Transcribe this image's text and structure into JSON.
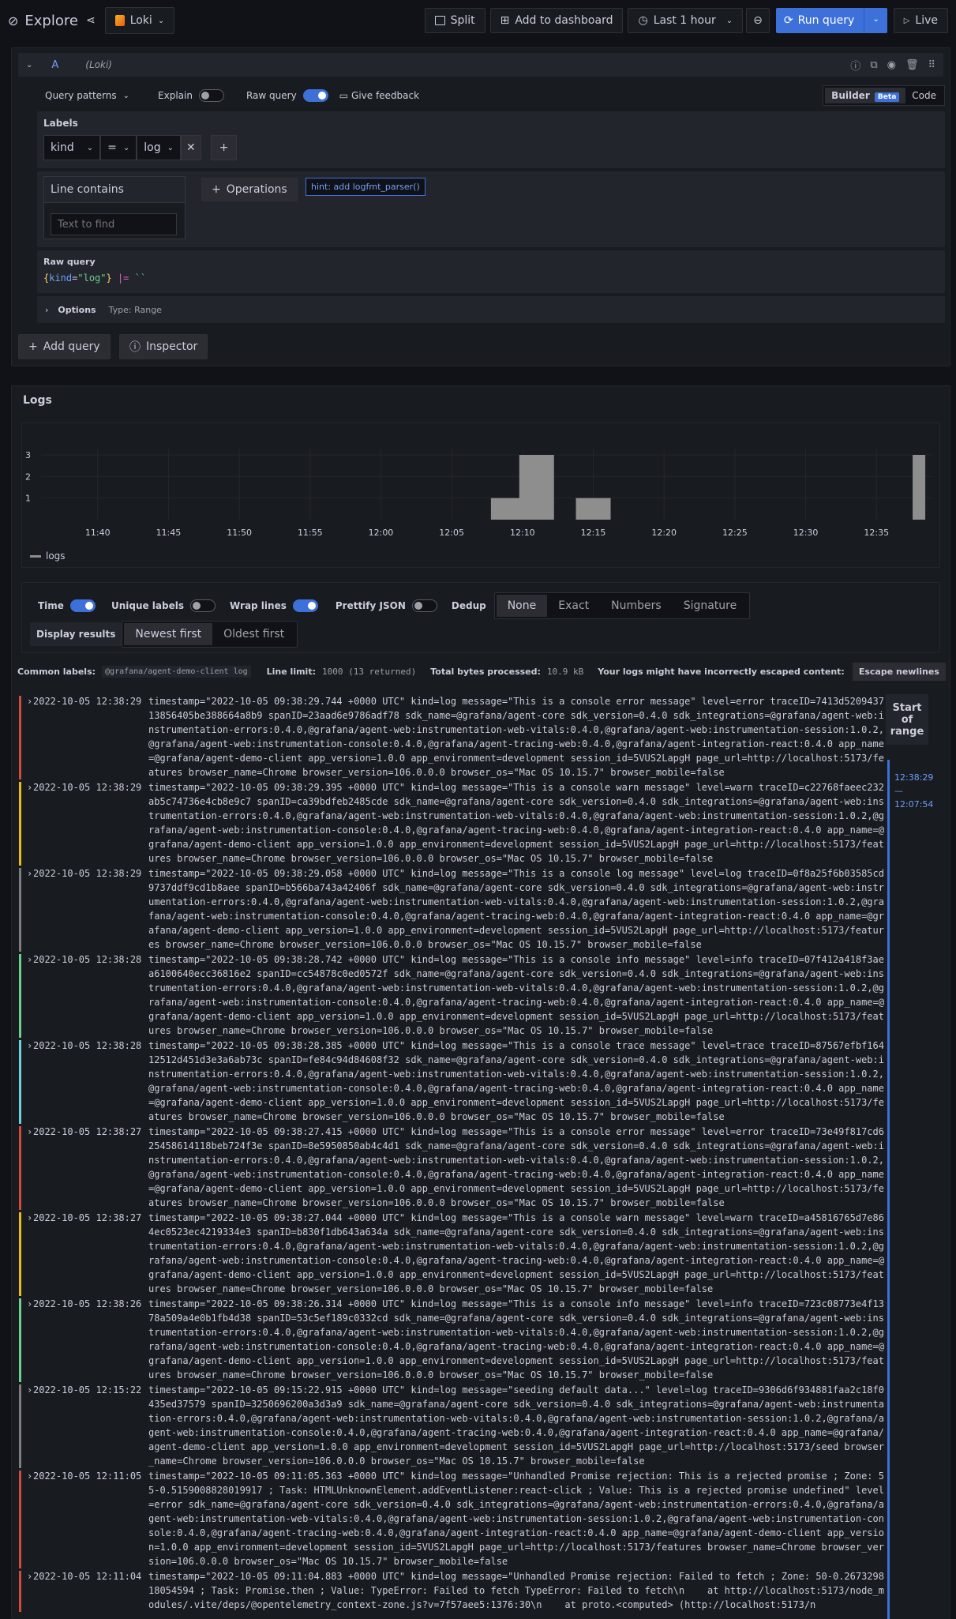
{
  "app": {
    "title": "Explore",
    "datasource": "Loki"
  },
  "toolbar": {
    "split": "Split",
    "add_to_dashboard": "Add to dashboard",
    "time_range": "Last 1 hour",
    "run_query": "Run query",
    "live": "Live"
  },
  "query": {
    "ref": "A",
    "ds_label": "(Loki)",
    "query_patterns": "Query patterns",
    "explain": "Explain",
    "raw_query_toggle": "Raw query",
    "feedback": "Give feedback",
    "builder": "Builder",
    "beta": "Beta",
    "code": "Code",
    "labels_title": "Labels",
    "label_key": "kind",
    "label_op": "=",
    "label_value": "log",
    "line_contains": "Line contains",
    "text_placeholder": "Text to find",
    "operations": "Operations",
    "hint": "hint: add logfmt_parser()",
    "raw_query_title": "Raw query",
    "raw_key": "kind",
    "raw_val": "\"log\"",
    "options": "Options",
    "options_type": "Type: Range",
    "add_query": "Add query",
    "inspector": "Inspector"
  },
  "logs_panel": {
    "title": "Logs",
    "legend": "logs"
  },
  "chart_data": {
    "type": "bar",
    "categories": [
      "11:40",
      "11:45",
      "11:50",
      "11:55",
      "12:00",
      "12:05",
      "12:10",
      "12:15",
      "12:20",
      "12:25",
      "12:30",
      "12:35"
    ],
    "ylim": [
      0,
      3
    ],
    "yticks": [
      "1",
      "2",
      "3"
    ],
    "bars": [
      {
        "x": "12:09",
        "value": 1
      },
      {
        "x": "12:11",
        "value": 3
      },
      {
        "x": "12:15",
        "value": 1
      },
      {
        "x": "12:38",
        "value": 3
      }
    ],
    "series": [
      {
        "name": "logs"
      }
    ],
    "color": "#8e8e8e",
    "grid": true,
    "legend": "bottom-left"
  },
  "options": {
    "time": "Time",
    "unique_labels": "Unique labels",
    "wrap_lines": "Wrap lines",
    "prettify": "Prettify JSON",
    "dedup": "Dedup",
    "dedup_opts": [
      "None",
      "Exact",
      "Numbers",
      "Signature"
    ],
    "display_results": "Display results",
    "order_opts": [
      "Newest first",
      "Oldest first"
    ]
  },
  "meta": {
    "common_labels": "Common labels:",
    "common_value": "@grafana/agent-demo-client log",
    "line_limit": "Line limit:",
    "line_limit_value": "1000 (13 returned)",
    "bytes": "Total bytes processed:",
    "bytes_value": "10.9 kB",
    "escape_warn": "Your logs might have incorrectly escaped content:",
    "escape_btn": "Escape newlines"
  },
  "range": {
    "start": "Start of range",
    "from": "12:38:29",
    "dash": "—",
    "to": "12:07:54"
  },
  "colors": {
    "error": "#d44a3a",
    "warn": "#ecbb13",
    "log": "#7d7d7d",
    "info": "#6ccf8e",
    "trace": "#6ed0e0",
    "accent": "#3d71d9"
  },
  "rows": [
    {
      "level": "error",
      "ts": "2022-10-05 12:38:29",
      "msg": "timestamp=\"2022-10-05 09:38:29.744 +0000 UTC\" kind=log message=\"This is a console error message\" level=error traceID=7413d520943713856405be388664a8b9 spanID=23aad6e9786adf78 sdk_name=@grafana/agent-core sdk_version=0.4.0 sdk_integrations=@grafana/agent-web:instrumentation-errors:0.4.0,@grafana/agent-web:instrumentation-web-vitals:0.4.0,@grafana/agent-web:instrumentation-session:1.0.2,@grafana/agent-web:instrumentation-console:0.4.0,@grafana/agent-tracing-web:0.4.0,@grafana/agent-integration-react:0.4.0 app_name=@grafana/agent-demo-client app_version=1.0.0 app_environment=development session_id=5VUS2LapgH page_url=http://localhost:5173/features browser_name=Chrome browser_version=106.0.0.0 browser_os=\"Mac OS 10.15.7\" browser_mobile=false"
    },
    {
      "level": "warn",
      "ts": "2022-10-05 12:38:29",
      "msg": "timestamp=\"2022-10-05 09:38:29.395 +0000 UTC\" kind=log message=\"This is a console warn message\" level=warn traceID=c22768faeec232ab5c74736e4cb8e9c7 spanID=ca39bdfeb2485cde sdk_name=@grafana/agent-core sdk_version=0.4.0 sdk_integrations=@grafana/agent-web:instrumentation-errors:0.4.0,@grafana/agent-web:instrumentation-web-vitals:0.4.0,@grafana/agent-web:instrumentation-session:1.0.2,@grafana/agent-web:instrumentation-console:0.4.0,@grafana/agent-tracing-web:0.4.0,@grafana/agent-integration-react:0.4.0 app_name=@grafana/agent-demo-client app_version=1.0.0 app_environment=development session_id=5VUS2LapgH page_url=http://localhost:5173/features browser_name=Chrome browser_version=106.0.0.0 browser_os=\"Mac OS 10.15.7\" browser_mobile=false"
    },
    {
      "level": "log",
      "ts": "2022-10-05 12:38:29",
      "msg": "timestamp=\"2022-10-05 09:38:29.058 +0000 UTC\" kind=log message=\"This is a console log message\" level=log traceID=0f8a25f6b03585cd9737ddf9cd1b8aee spanID=b566ba743a42406f sdk_name=@grafana/agent-core sdk_version=0.4.0 sdk_integrations=@grafana/agent-web:instrumentation-errors:0.4.0,@grafana/agent-web:instrumentation-web-vitals:0.4.0,@grafana/agent-web:instrumentation-session:1.0.2,@grafana/agent-web:instrumentation-console:0.4.0,@grafana/agent-tracing-web:0.4.0,@grafana/agent-integration-react:0.4.0 app_name=@grafana/agent-demo-client app_version=1.0.0 app_environment=development session_id=5VUS2LapgH page_url=http://localhost:5173/features browser_name=Chrome browser_version=106.0.0.0 browser_os=\"Mac OS 10.15.7\" browser_mobile=false"
    },
    {
      "level": "info",
      "ts": "2022-10-05 12:38:28",
      "msg": "timestamp=\"2022-10-05 09:38:28.742 +0000 UTC\" kind=log message=\"This is a console info message\" level=info traceID=07f412a418f3aea6100640ecc36816e2 spanID=cc54878c0ed0572f sdk_name=@grafana/agent-core sdk_version=0.4.0 sdk_integrations=@grafana/agent-web:instrumentation-errors:0.4.0,@grafana/agent-web:instrumentation-web-vitals:0.4.0,@grafana/agent-web:instrumentation-session:1.0.2,@grafana/agent-web:instrumentation-console:0.4.0,@grafana/agent-tracing-web:0.4.0,@grafana/agent-integration-react:0.4.0 app_name=@grafana/agent-demo-client app_version=1.0.0 app_environment=development session_id=5VUS2LapgH page_url=http://localhost:5173/features browser_name=Chrome browser_version=106.0.0.0 browser_os=\"Mac OS 10.15.7\" browser_mobile=false"
    },
    {
      "level": "trace",
      "ts": "2022-10-05 12:38:28",
      "msg": "timestamp=\"2022-10-05 09:38:28.385 +0000 UTC\" kind=log message=\"This is a console trace message\" level=trace traceID=87567efbf16412512d451d3e3a6ab73c spanID=fe84c94d84608f32 sdk_name=@grafana/agent-core sdk_version=0.4.0 sdk_integrations=@grafana/agent-web:instrumentation-errors:0.4.0,@grafana/agent-web:instrumentation-web-vitals:0.4.0,@grafana/agent-web:instrumentation-session:1.0.2,@grafana/agent-web:instrumentation-console:0.4.0,@grafana/agent-tracing-web:0.4.0,@grafana/agent-integration-react:0.4.0 app_name=@grafana/agent-demo-client app_version=1.0.0 app_environment=development session_id=5VUS2LapgH page_url=http://localhost:5173/features browser_name=Chrome browser_version=106.0.0.0 browser_os=\"Mac OS 10.15.7\" browser_mobile=false"
    },
    {
      "level": "error",
      "ts": "2022-10-05 12:38:27",
      "msg": "timestamp=\"2022-10-05 09:38:27.415 +0000 UTC\" kind=log message=\"This is a console error message\" level=error traceID=73e49f817cd625458614118beb724f3e spanID=8e5950850ab4c4d1 sdk_name=@grafana/agent-core sdk_version=0.4.0 sdk_integrations=@grafana/agent-web:instrumentation-errors:0.4.0,@grafana/agent-web:instrumentation-web-vitals:0.4.0,@grafana/agent-web:instrumentation-session:1.0.2,@grafana/agent-web:instrumentation-console:0.4.0,@grafana/agent-tracing-web:0.4.0,@grafana/agent-integration-react:0.4.0 app_name=@grafana/agent-demo-client app_version=1.0.0 app_environment=development session_id=5VUS2LapgH page_url=http://localhost:5173/features browser_name=Chrome browser_version=106.0.0.0 browser_os=\"Mac OS 10.15.7\" browser_mobile=false"
    },
    {
      "level": "warn",
      "ts": "2022-10-05 12:38:27",
      "msg": "timestamp=\"2022-10-05 09:38:27.044 +0000 UTC\" kind=log message=\"This is a console warn message\" level=warn traceID=a45816765d7e864ec0523ec4219334e3 spanID=b830f1db643a634a sdk_name=@grafana/agent-core sdk_version=0.4.0 sdk_integrations=@grafana/agent-web:instrumentation-errors:0.4.0,@grafana/agent-web:instrumentation-web-vitals:0.4.0,@grafana/agent-web:instrumentation-session:1.0.2,@grafana/agent-web:instrumentation-console:0.4.0,@grafana/agent-tracing-web:0.4.0,@grafana/agent-integration-react:0.4.0 app_name=@grafana/agent-demo-client app_version=1.0.0 app_environment=development session_id=5VUS2LapgH page_url=http://localhost:5173/features browser_name=Chrome browser_version=106.0.0.0 browser_os=\"Mac OS 10.15.7\" browser_mobile=false"
    },
    {
      "level": "info",
      "ts": "2022-10-05 12:38:26",
      "msg": "timestamp=\"2022-10-05 09:38:26.314 +0000 UTC\" kind=log message=\"This is a console info message\" level=info traceID=723c08773e4f1378a509a4e0b1fb4d38 spanID=53c5ef189c0332cd sdk_name=@grafana/agent-core sdk_version=0.4.0 sdk_integrations=@grafana/agent-web:instrumentation-errors:0.4.0,@grafana/agent-web:instrumentation-web-vitals:0.4.0,@grafana/agent-web:instrumentation-session:1.0.2,@grafana/agent-web:instrumentation-console:0.4.0,@grafana/agent-tracing-web:0.4.0,@grafana/agent-integration-react:0.4.0 app_name=@grafana/agent-demo-client app_version=1.0.0 app_environment=development session_id=5VUS2LapgH page_url=http://localhost:5173/features browser_name=Chrome browser_version=106.0.0.0 browser_os=\"Mac OS 10.15.7\" browser_mobile=false"
    },
    {
      "level": "log",
      "ts": "2022-10-05 12:15:22",
      "msg": "timestamp=\"2022-10-05 09:15:22.915 +0000 UTC\" kind=log message=\"seeding default data...\" level=log traceID=9306d6f934881faa2c18f0435ed37579 spanID=3250696200a3d3a9 sdk_name=@grafana/agent-core sdk_version=0.4.0 sdk_integrations=@grafana/agent-web:instrumentation-errors:0.4.0,@grafana/agent-web:instrumentation-web-vitals:0.4.0,@grafana/agent-web:instrumentation-session:1.0.2,@grafana/agent-web:instrumentation-console:0.4.0,@grafana/agent-tracing-web:0.4.0,@grafana/agent-integration-react:0.4.0 app_name=@grafana/agent-demo-client app_version=1.0.0 app_environment=development session_id=5VUS2LapgH page_url=http://localhost:5173/seed browser_name=Chrome browser_version=106.0.0.0 browser_os=\"Mac OS 10.15.7\" browser_mobile=false"
    },
    {
      "level": "error",
      "ts": "2022-10-05 12:11:05",
      "msg": "timestamp=\"2022-10-05 09:11:05.363 +0000 UTC\" kind=log message=\"Unhandled Promise rejection: This is a rejected promise ; Zone: 55-0.5159008828019917 ; Task: HTMLUnknownElement.addEventListener:react-click ; Value: This is a rejected promise undefined\" level=error sdk_name=@grafana/agent-core sdk_version=0.4.0 sdk_integrations=@grafana/agent-web:instrumentation-errors:0.4.0,@grafana/agent-web:instrumentation-web-vitals:0.4.0,@grafana/agent-web:instrumentation-session:1.0.2,@grafana/agent-web:instrumentation-console:0.4.0,@grafana/agent-tracing-web:0.4.0,@grafana/agent-integration-react:0.4.0 app_name=@grafana/agent-demo-client app_version=1.0.0 app_environment=development session_id=5VUS2LapgH page_url=http://localhost:5173/features browser_name=Chrome browser_version=106.0.0.0 browser_os=\"Mac OS 10.15.7\" browser_mobile=false"
    },
    {
      "level": "error",
      "ts": "2022-10-05 12:11:04",
      "msg": "timestamp=\"2022-10-05 09:11:04.883 +0000 UTC\" kind=log message=\"Unhandled Promise rejection: Failed to fetch ; Zone: 50-0.267329818054594 ; Task: Promise.then ; Value: TypeError: Failed to fetch TypeError: Failed to fetch\\n    at http://localhost:5173/node_modules/.vite/deps/@opentelemetry_context-zone.js?v=7f57aee5:1376:30\\n    at proto.<computed> (http://localhost:5173/n"
    }
  ]
}
